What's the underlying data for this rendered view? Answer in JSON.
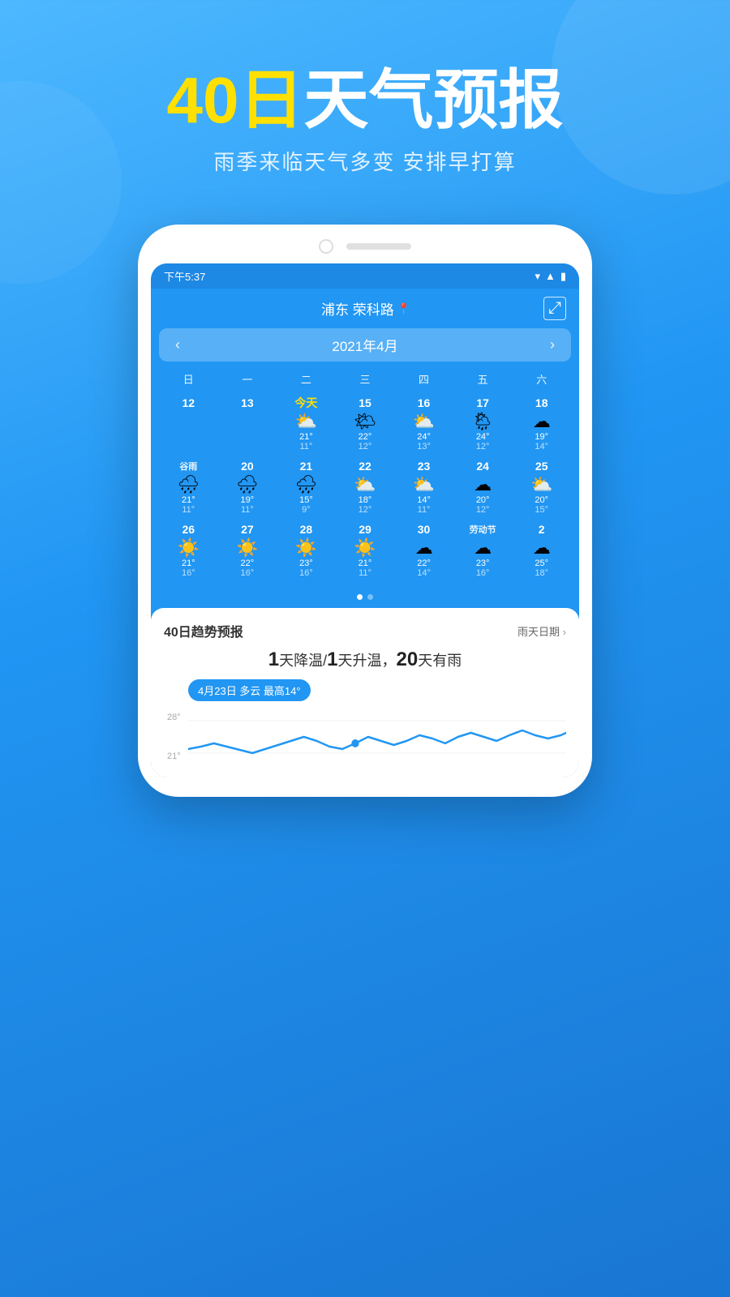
{
  "hero": {
    "title_yellow": "40日",
    "title_white": "天气预报",
    "subtitle": "雨季来临天气多变 安排早打算"
  },
  "status_bar": {
    "time": "下午5:37"
  },
  "app_header": {
    "location": "浦东 荣科路",
    "share_label": "⤢"
  },
  "calendar": {
    "month": "2021年4月",
    "weekdays": [
      "日",
      "一",
      "二",
      "三",
      "四",
      "五",
      "六"
    ],
    "weeks": [
      {
        "cells": [
          {
            "date": "12",
            "icon": "",
            "hi": "",
            "lo": "",
            "empty": true
          },
          {
            "date": "13",
            "icon": "",
            "hi": "",
            "lo": "",
            "empty": true
          },
          {
            "date": "今天",
            "icon": "⛅",
            "hi": "21°",
            "lo": "11°",
            "today": true
          },
          {
            "date": "15",
            "icon": "☀️",
            "hi": "22°",
            "lo": "12°"
          },
          {
            "date": "16",
            "icon": "⛅",
            "hi": "24°",
            "lo": "13°"
          },
          {
            "date": "17",
            "icon": "🌧",
            "hi": "24°",
            "lo": "12°"
          },
          {
            "date": "18",
            "icon": "☁",
            "hi": "19°",
            "lo": "14°"
          }
        ]
      },
      {
        "cells": [
          {
            "date": "谷雨",
            "icon": "🌧",
            "hi": "21°",
            "lo": "11°",
            "solarterm": true
          },
          {
            "date": "20",
            "icon": "🌧",
            "hi": "19°",
            "lo": "11°"
          },
          {
            "date": "21",
            "icon": "🌧",
            "hi": "15°",
            "lo": "9°"
          },
          {
            "date": "22",
            "icon": "⛅",
            "hi": "18°",
            "lo": "12°"
          },
          {
            "date": "23",
            "icon": "⛅",
            "hi": "14°",
            "lo": "11°"
          },
          {
            "date": "24",
            "icon": "☁",
            "hi": "20°",
            "lo": "12°"
          },
          {
            "date": "25",
            "icon": "⛅",
            "hi": "20°",
            "lo": "15°"
          }
        ]
      },
      {
        "cells": [
          {
            "date": "26",
            "icon": "☀️",
            "hi": "21°",
            "lo": "16°"
          },
          {
            "date": "27",
            "icon": "☀️",
            "hi": "22°",
            "lo": "16°"
          },
          {
            "date": "28",
            "icon": "☀️",
            "hi": "23°",
            "lo": "16°"
          },
          {
            "date": "29",
            "icon": "☀️",
            "hi": "21°",
            "lo": "11°"
          },
          {
            "date": "30",
            "icon": "☁",
            "hi": "22°",
            "lo": "14°"
          },
          {
            "date": "劳动节",
            "icon": "☁",
            "hi": "23°",
            "lo": "16°",
            "solarterm": true
          },
          {
            "date": "2",
            "icon": "☁",
            "hi": "25°",
            "lo": "18°"
          }
        ]
      }
    ]
  },
  "trend_section": {
    "title": "40日趋势预报",
    "rain_link": "雨天日期",
    "summary": "1天降温/1天升温，20天有雨",
    "tooltip": "4月23日 多云 最高14°",
    "chart_labels": [
      "28°",
      "21°"
    ],
    "chart_data": [
      12,
      14,
      16,
      14,
      12,
      10,
      12,
      14,
      16,
      18,
      16,
      14,
      12,
      14,
      16,
      18,
      20,
      18,
      16,
      14,
      16,
      18,
      20,
      18,
      16,
      14,
      12,
      14,
      16,
      18
    ]
  }
}
